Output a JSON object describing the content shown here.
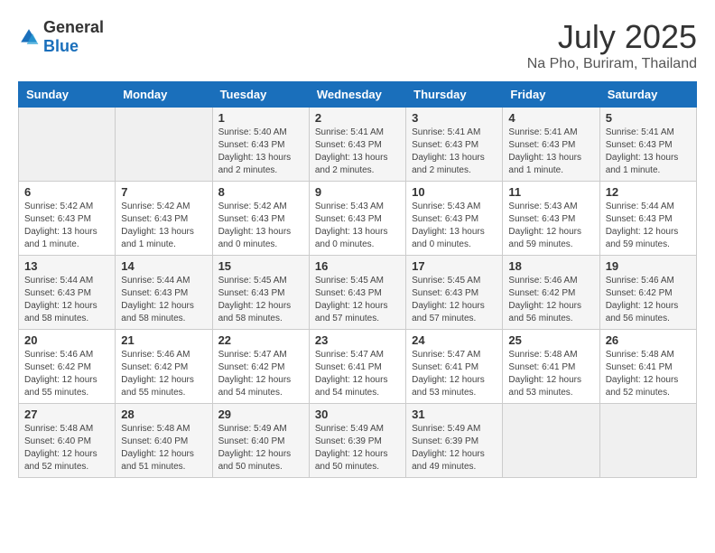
{
  "header": {
    "logo_general": "General",
    "logo_blue": "Blue",
    "month": "July 2025",
    "location": "Na Pho, Buriram, Thailand"
  },
  "days_of_week": [
    "Sunday",
    "Monday",
    "Tuesday",
    "Wednesday",
    "Thursday",
    "Friday",
    "Saturday"
  ],
  "weeks": [
    [
      {
        "day": "",
        "info": ""
      },
      {
        "day": "",
        "info": ""
      },
      {
        "day": "1",
        "info": "Sunrise: 5:40 AM\nSunset: 6:43 PM\nDaylight: 13 hours and 2 minutes."
      },
      {
        "day": "2",
        "info": "Sunrise: 5:41 AM\nSunset: 6:43 PM\nDaylight: 13 hours and 2 minutes."
      },
      {
        "day": "3",
        "info": "Sunrise: 5:41 AM\nSunset: 6:43 PM\nDaylight: 13 hours and 2 minutes."
      },
      {
        "day": "4",
        "info": "Sunrise: 5:41 AM\nSunset: 6:43 PM\nDaylight: 13 hours and 1 minute."
      },
      {
        "day": "5",
        "info": "Sunrise: 5:41 AM\nSunset: 6:43 PM\nDaylight: 13 hours and 1 minute."
      }
    ],
    [
      {
        "day": "6",
        "info": "Sunrise: 5:42 AM\nSunset: 6:43 PM\nDaylight: 13 hours and 1 minute."
      },
      {
        "day": "7",
        "info": "Sunrise: 5:42 AM\nSunset: 6:43 PM\nDaylight: 13 hours and 1 minute."
      },
      {
        "day": "8",
        "info": "Sunrise: 5:42 AM\nSunset: 6:43 PM\nDaylight: 13 hours and 0 minutes."
      },
      {
        "day": "9",
        "info": "Sunrise: 5:43 AM\nSunset: 6:43 PM\nDaylight: 13 hours and 0 minutes."
      },
      {
        "day": "10",
        "info": "Sunrise: 5:43 AM\nSunset: 6:43 PM\nDaylight: 13 hours and 0 minutes."
      },
      {
        "day": "11",
        "info": "Sunrise: 5:43 AM\nSunset: 6:43 PM\nDaylight: 12 hours and 59 minutes."
      },
      {
        "day": "12",
        "info": "Sunrise: 5:44 AM\nSunset: 6:43 PM\nDaylight: 12 hours and 59 minutes."
      }
    ],
    [
      {
        "day": "13",
        "info": "Sunrise: 5:44 AM\nSunset: 6:43 PM\nDaylight: 12 hours and 58 minutes."
      },
      {
        "day": "14",
        "info": "Sunrise: 5:44 AM\nSunset: 6:43 PM\nDaylight: 12 hours and 58 minutes."
      },
      {
        "day": "15",
        "info": "Sunrise: 5:45 AM\nSunset: 6:43 PM\nDaylight: 12 hours and 58 minutes."
      },
      {
        "day": "16",
        "info": "Sunrise: 5:45 AM\nSunset: 6:43 PM\nDaylight: 12 hours and 57 minutes."
      },
      {
        "day": "17",
        "info": "Sunrise: 5:45 AM\nSunset: 6:43 PM\nDaylight: 12 hours and 57 minutes."
      },
      {
        "day": "18",
        "info": "Sunrise: 5:46 AM\nSunset: 6:42 PM\nDaylight: 12 hours and 56 minutes."
      },
      {
        "day": "19",
        "info": "Sunrise: 5:46 AM\nSunset: 6:42 PM\nDaylight: 12 hours and 56 minutes."
      }
    ],
    [
      {
        "day": "20",
        "info": "Sunrise: 5:46 AM\nSunset: 6:42 PM\nDaylight: 12 hours and 55 minutes."
      },
      {
        "day": "21",
        "info": "Sunrise: 5:46 AM\nSunset: 6:42 PM\nDaylight: 12 hours and 55 minutes."
      },
      {
        "day": "22",
        "info": "Sunrise: 5:47 AM\nSunset: 6:42 PM\nDaylight: 12 hours and 54 minutes."
      },
      {
        "day": "23",
        "info": "Sunrise: 5:47 AM\nSunset: 6:41 PM\nDaylight: 12 hours and 54 minutes."
      },
      {
        "day": "24",
        "info": "Sunrise: 5:47 AM\nSunset: 6:41 PM\nDaylight: 12 hours and 53 minutes."
      },
      {
        "day": "25",
        "info": "Sunrise: 5:48 AM\nSunset: 6:41 PM\nDaylight: 12 hours and 53 minutes."
      },
      {
        "day": "26",
        "info": "Sunrise: 5:48 AM\nSunset: 6:41 PM\nDaylight: 12 hours and 52 minutes."
      }
    ],
    [
      {
        "day": "27",
        "info": "Sunrise: 5:48 AM\nSunset: 6:40 PM\nDaylight: 12 hours and 52 minutes."
      },
      {
        "day": "28",
        "info": "Sunrise: 5:48 AM\nSunset: 6:40 PM\nDaylight: 12 hours and 51 minutes."
      },
      {
        "day": "29",
        "info": "Sunrise: 5:49 AM\nSunset: 6:40 PM\nDaylight: 12 hours and 50 minutes."
      },
      {
        "day": "30",
        "info": "Sunrise: 5:49 AM\nSunset: 6:39 PM\nDaylight: 12 hours and 50 minutes."
      },
      {
        "day": "31",
        "info": "Sunrise: 5:49 AM\nSunset: 6:39 PM\nDaylight: 12 hours and 49 minutes."
      },
      {
        "day": "",
        "info": ""
      },
      {
        "day": "",
        "info": ""
      }
    ]
  ]
}
